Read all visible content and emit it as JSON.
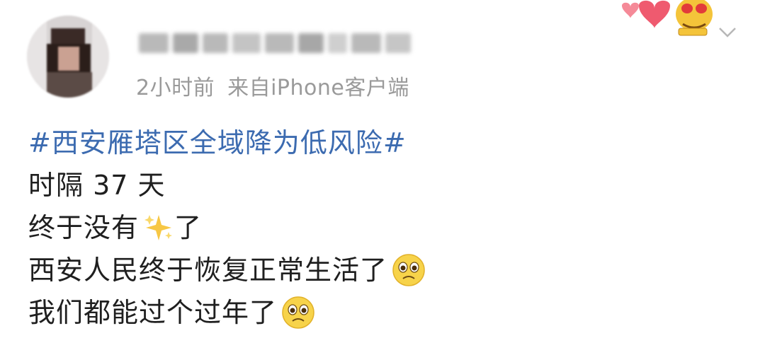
{
  "post": {
    "timestamp": "2小时前",
    "source_prefix": "来自",
    "source_device": "iPhone",
    "source_suffix": "客户端",
    "lines": [
      "#西安雁塔区全域降为低风险#",
      "时隔 37 天",
      "终于没有",
      "了",
      "西安人民终于恢复正常生活了",
      "我们都能过个过年了"
    ]
  },
  "icons": {
    "sparkles": "sparkles-icon",
    "pleading_face": "pleading-face-icon",
    "chevron": "chevron-down-icon"
  },
  "colors": {
    "topic": "#3c6bb0",
    "meta": "#9a9a9a",
    "text": "#1f1f1f"
  }
}
